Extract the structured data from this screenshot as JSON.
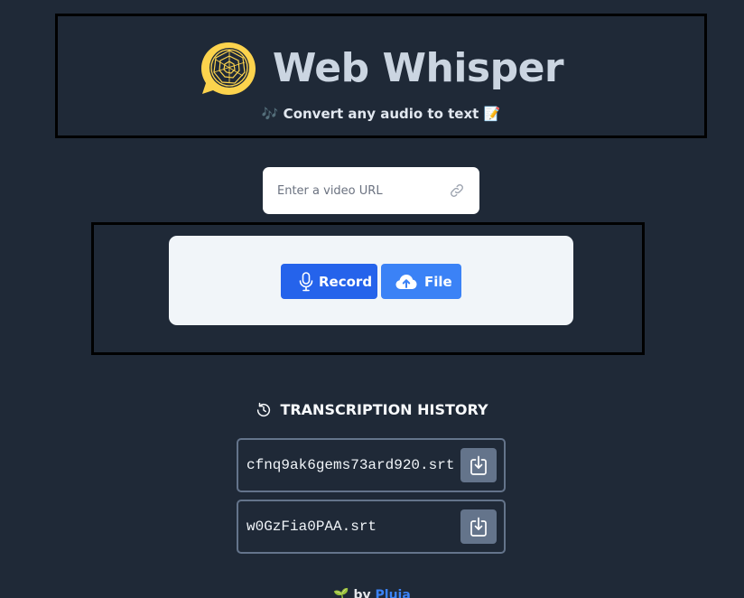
{
  "header": {
    "title": "Web Whisper",
    "tagline": "🎶 Convert any audio to text 📝",
    "logo_color": "#fcd34d"
  },
  "url_input": {
    "placeholder": "Enter a video URL",
    "value": "",
    "icon": "link-icon"
  },
  "upload": {
    "record_label": "Record",
    "record_icon": "microphone-icon",
    "file_label": "File",
    "file_icon": "cloud-upload-icon",
    "record_color": "#2563eb",
    "file_color": "#3b82f6"
  },
  "history": {
    "heading": "TRANSCRIPTION HISTORY",
    "heading_icon": "history-icon",
    "items": [
      {
        "filename": "cfnq9ak6gems73ard920.srt",
        "action_icon": "download-icon"
      },
      {
        "filename": "w0GzFia0PAA.srt",
        "action_icon": "download-icon"
      }
    ]
  },
  "footer": {
    "prefix": "🌱 by",
    "author": "Pluja"
  }
}
